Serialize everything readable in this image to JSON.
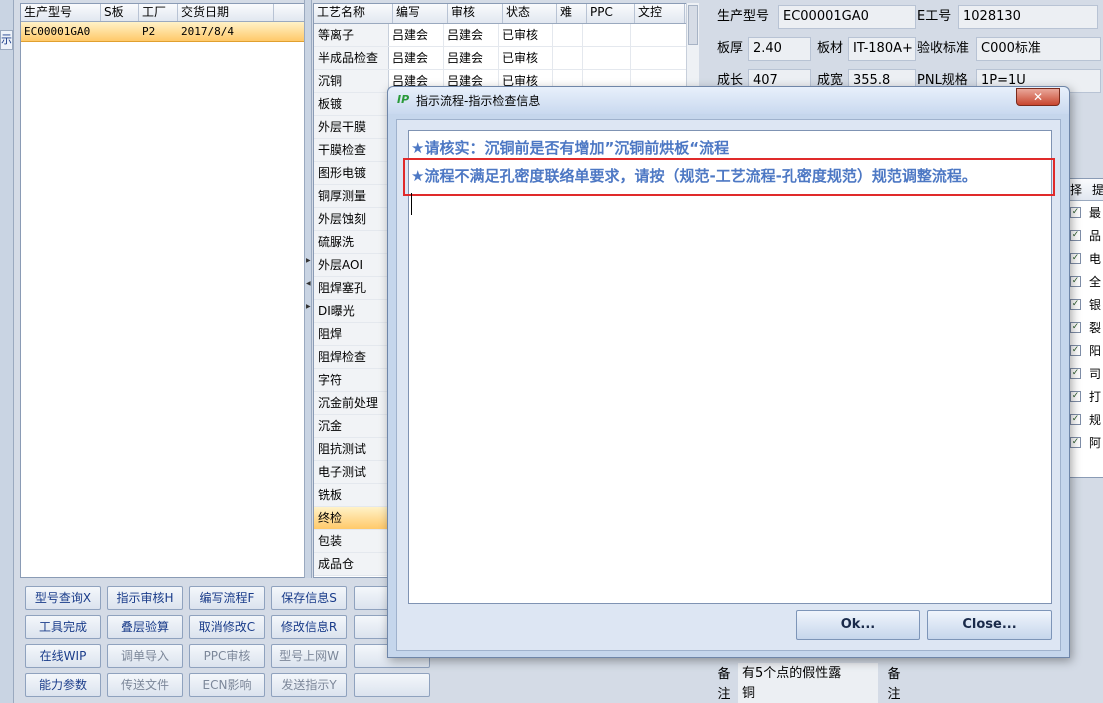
{
  "left_strip": {
    "tab_label": "示"
  },
  "orders": {
    "headers": [
      "生产型号",
      "S板",
      "工厂",
      "交货日期"
    ],
    "rows": [
      {
        "model": "EC00001GA0",
        "s_board": "",
        "factory": "P2",
        "date": "2017/8/4"
      }
    ]
  },
  "process": {
    "headers": [
      "工艺名称",
      "编写",
      "审核",
      "状态",
      "难",
      "PPC",
      "文控"
    ],
    "rows": [
      {
        "name": "等离子",
        "writer": "吕建会",
        "reviewer": "吕建会",
        "status": "已审核"
      },
      {
        "name": "半成品检查",
        "writer": "吕建会",
        "reviewer": "吕建会",
        "status": "已审核"
      },
      {
        "name": "沉铜",
        "writer": "吕建会",
        "reviewer": "吕建会",
        "status": "已审核"
      },
      {
        "name": "板镀",
        "writer": "",
        "reviewer": "",
        "status": ""
      },
      {
        "name": "外层干膜",
        "writer": "",
        "reviewer": "",
        "status": ""
      },
      {
        "name": "干膜检查",
        "writer": "",
        "reviewer": "",
        "status": ""
      },
      {
        "name": "图形电镀",
        "writer": "",
        "reviewer": "",
        "status": ""
      },
      {
        "name": "铜厚测量",
        "writer": "",
        "reviewer": "",
        "status": ""
      },
      {
        "name": "外层蚀刻",
        "writer": "",
        "reviewer": "",
        "status": ""
      },
      {
        "name": "硫脲洗",
        "writer": "",
        "reviewer": "",
        "status": ""
      },
      {
        "name": "外层AOI",
        "writer": "",
        "reviewer": "",
        "status": ""
      },
      {
        "name": "阻焊塞孔",
        "writer": "",
        "reviewer": "",
        "status": ""
      },
      {
        "name": "DI曝光",
        "writer": "",
        "reviewer": "",
        "status": ""
      },
      {
        "name": "阻焊",
        "writer": "",
        "reviewer": "",
        "status": ""
      },
      {
        "name": "阻焊检查",
        "writer": "",
        "reviewer": "",
        "status": ""
      },
      {
        "name": "字符",
        "writer": "",
        "reviewer": "",
        "status": ""
      },
      {
        "name": "沉金前处理",
        "writer": "",
        "reviewer": "",
        "status": ""
      },
      {
        "name": "沉金",
        "writer": "",
        "reviewer": "",
        "status": ""
      },
      {
        "name": "阻抗测试",
        "writer": "",
        "reviewer": "",
        "status": ""
      },
      {
        "name": "电子测试",
        "writer": "",
        "reviewer": "",
        "status": ""
      },
      {
        "name": "铣板",
        "writer": "",
        "reviewer": "",
        "status": ""
      },
      {
        "name": "终检",
        "writer": "",
        "reviewer": "",
        "status": ""
      },
      {
        "name": "包装",
        "writer": "",
        "reviewer": "",
        "status": ""
      },
      {
        "name": "成品仓",
        "writer": "",
        "reviewer": "",
        "status": ""
      }
    ],
    "selected_index": 21
  },
  "detail": {
    "model_label": "生产型号",
    "model_value": "EC00001GA0",
    "e_label": "E工号",
    "e_value": "1028130",
    "thickness_label": "板厚",
    "thickness_value": "2.40",
    "material_label": "板材",
    "material_value": "IT-180A+",
    "standard_label": "验收标准",
    "standard_value": "C000标准",
    "length_label": "成长",
    "length_value": "407",
    "width_label": "成宽",
    "width_value": "355.8",
    "pnl_label": "PNL规格",
    "pnl_value": "1P=1U"
  },
  "checklist": {
    "header": "择",
    "header2": "提",
    "rows": [
      "最",
      "品",
      "电",
      "全",
      "银",
      "裂",
      "阳",
      "司",
      "打",
      "规",
      "阿"
    ]
  },
  "buttons": [
    {
      "label": "型号查询X",
      "disabled": false
    },
    {
      "label": "指示审核H",
      "disabled": false
    },
    {
      "label": "编写流程F",
      "disabled": false
    },
    {
      "label": "保存信息S",
      "disabled": false
    },
    {
      "label": "工具完成",
      "disabled": false
    },
    {
      "label": "叠层验算",
      "disabled": false
    },
    {
      "label": "取消修改C",
      "disabled": false
    },
    {
      "label": "修改信息R",
      "disabled": false
    },
    {
      "label": "在线WIP",
      "disabled": false
    },
    {
      "label": "调单导入",
      "disabled": true
    },
    {
      "label": "PPC审核",
      "disabled": true
    },
    {
      "label": "型号上网W",
      "disabled": true
    },
    {
      "label": "能力参数",
      "disabled": false
    },
    {
      "label": "传送文件",
      "disabled": true
    },
    {
      "label": "ECN影响",
      "disabled": true
    },
    {
      "label": "发送指示Y",
      "disabled": true
    }
  ],
  "note": {
    "label_top": "备",
    "label_bottom": "注",
    "text_line1": "有5个点的假性露",
    "text_line2": "铜"
  },
  "dialog": {
    "title": "指示流程-指示检查信息",
    "close_glyph": "✕",
    "message_line1": "★请核实：沉铜前是否有增加”沉铜前烘板“流程",
    "message_line2": "★流程不满足孔密度联络单要求，请按（规范-工艺流程-孔密度规范）规范调整流程。",
    "ok_label": "Ok...",
    "close_label": "Close..."
  }
}
